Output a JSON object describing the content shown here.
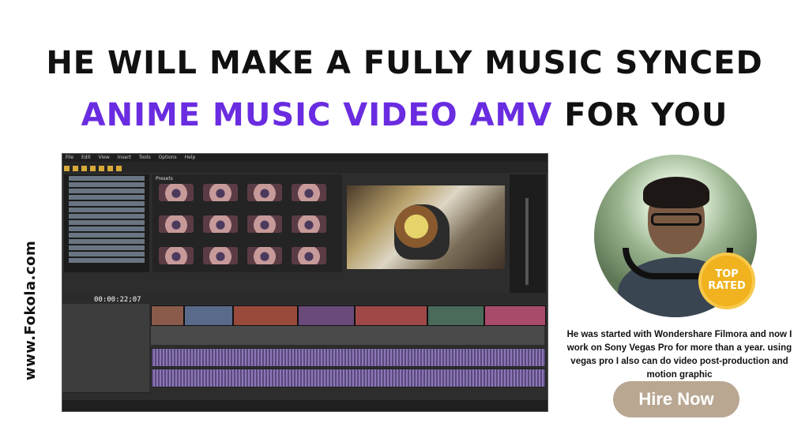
{
  "headline": {
    "line1": "HE WILL MAKE A FULLY MUSIC SYNCED",
    "line2_highlight": "ANIME MUSIC VIDEO AMV",
    "line2_rest": " FOR YOU"
  },
  "side_url": "www.Fokola.com",
  "editor": {
    "menu": [
      "File",
      "Edit",
      "View",
      "Insert",
      "Tools",
      "Options",
      "Help"
    ],
    "presets_title": "Presets",
    "timecode": "00:00:22;07"
  },
  "badge": {
    "line1": "TOP",
    "line2": "RATED"
  },
  "bio": "He was started with Wondershare Filmora and now I work on Sony Vegas Pro for more than a year. using vegas pro I also can do video post-production and motion graphic",
  "cta": {
    "label": "Hire Now"
  },
  "colors": {
    "accent_purple": "#6a2ce0",
    "badge": "#f0b21e",
    "button": "#b9a792"
  }
}
